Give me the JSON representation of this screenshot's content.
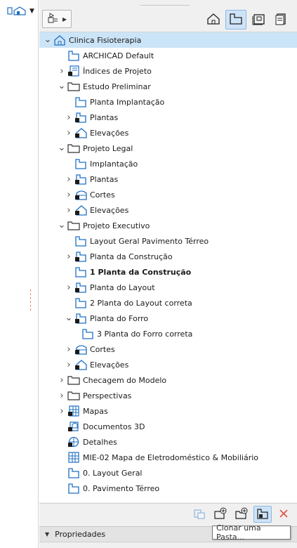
{
  "left_strip": {
    "nav_icon": "house-plan-icon",
    "caret_icon": "caret-down-icon"
  },
  "toolbar": {
    "left_button_icon": "project-map-icon",
    "buttons": [
      {
        "name": "project-map",
        "icon": "house-outline-icon"
      },
      {
        "name": "view-map",
        "icon": "floor-plan-icon",
        "active": true
      },
      {
        "name": "layout-book",
        "icon": "layout-icon"
      },
      {
        "name": "publisher-sets",
        "icon": "publisher-icon"
      }
    ]
  },
  "tree": {
    "rows": [
      {
        "label": "Clinica Fisioterapia",
        "level": 0,
        "toggle": "expanded",
        "icon": "house-icon",
        "selected": true
      },
      {
        "label": "ARCHICAD Default",
        "level": 1,
        "toggle": "none",
        "icon": "plan-view-icon"
      },
      {
        "label": "Índices de Projeto",
        "level": 1,
        "toggle": "collapsed",
        "icon": "index-icon"
      },
      {
        "label": "Estudo Preliminar",
        "level": 1,
        "toggle": "expanded",
        "icon": "folder-icon"
      },
      {
        "label": "Planta Implantação",
        "level": 2,
        "toggle": "none",
        "icon": "plan-view-icon"
      },
      {
        "label": "Plantas",
        "level": 2,
        "toggle": "collapsed",
        "icon": "plan-clone-icon"
      },
      {
        "label": "Elevações",
        "level": 2,
        "toggle": "collapsed",
        "icon": "elevation-clone-icon"
      },
      {
        "label": "Projeto Legal",
        "level": 1,
        "toggle": "expanded",
        "icon": "folder-icon"
      },
      {
        "label": "Implantação",
        "level": 2,
        "toggle": "none",
        "icon": "plan-view-icon"
      },
      {
        "label": "Plantas",
        "level": 2,
        "toggle": "collapsed",
        "icon": "plan-clone-icon"
      },
      {
        "label": "Cortes",
        "level": 2,
        "toggle": "collapsed",
        "icon": "section-clone-icon"
      },
      {
        "label": "Elevações",
        "level": 2,
        "toggle": "collapsed",
        "icon": "elevation-clone-icon"
      },
      {
        "label": "Projeto Executivo",
        "level": 1,
        "toggle": "expanded",
        "icon": "folder-icon"
      },
      {
        "label": "Layout Geral Pavimento Térreo",
        "level": 2,
        "toggle": "none",
        "icon": "plan-view-icon"
      },
      {
        "label": "Planta da Construção",
        "level": 2,
        "toggle": "collapsed",
        "icon": "plan-clone-icon"
      },
      {
        "label": "1 Planta da Construção",
        "level": 2,
        "toggle": "none",
        "icon": "plan-view-icon",
        "bold": true
      },
      {
        "label": "Planta do Layout",
        "level": 2,
        "toggle": "collapsed",
        "icon": "plan-clone-icon"
      },
      {
        "label": "2 Planta do Layout correta",
        "level": 2,
        "toggle": "none",
        "icon": "plan-view-icon"
      },
      {
        "label": "Planta do Forro",
        "level": 2,
        "toggle": "expanded",
        "icon": "plan-clone-icon"
      },
      {
        "label": "3 Planta do Forro correta",
        "level": 3,
        "toggle": "none",
        "icon": "plan-view-icon"
      },
      {
        "label": "Cortes",
        "level": 2,
        "toggle": "collapsed",
        "icon": "section-clone-icon"
      },
      {
        "label": "Elevações",
        "level": 2,
        "toggle": "collapsed",
        "icon": "elevation-clone-icon"
      },
      {
        "label": "Checagem do Modelo",
        "level": 1,
        "toggle": "collapsed",
        "icon": "folder-icon"
      },
      {
        "label": "Perspectivas",
        "level": 1,
        "toggle": "collapsed",
        "icon": "folder-icon"
      },
      {
        "label": "Mapas",
        "level": 1,
        "toggle": "collapsed",
        "icon": "schedule-icon"
      },
      {
        "label": "Documentos 3D",
        "level": 1,
        "toggle": "none",
        "icon": "document-3d-icon"
      },
      {
        "label": "Detalhes",
        "level": 1,
        "toggle": "none",
        "icon": "detail-icon"
      },
      {
        "label": "MIE-02 Mapa de Eletrodoméstico & Mobiliário",
        "level": 1,
        "toggle": "none",
        "icon": "schedule-grid-icon"
      },
      {
        "label": "0. Layout Geral",
        "level": 1,
        "toggle": "none",
        "icon": "plan-view-icon"
      },
      {
        "label": "0. Pavimento Térreo",
        "level": 1,
        "toggle": "none",
        "icon": "plan-view-icon"
      }
    ]
  },
  "bottom_toolbar": {
    "buttons": [
      {
        "name": "clone-folder-disabled",
        "icon": "clone-icon"
      },
      {
        "name": "new-view",
        "icon": "new-view-icon"
      },
      {
        "name": "new-folder",
        "icon": "new-folder-icon"
      },
      {
        "name": "clone-a-folder",
        "icon": "clone-folder-icon",
        "active": true
      },
      {
        "name": "delete",
        "icon": "delete-icon"
      }
    ],
    "tooltip": "Clonar uma Pasta..."
  },
  "properties": {
    "label": "Propriedades"
  },
  "colors": {
    "selection": "#cce4f7",
    "active_button": "#cfe3f7",
    "accent_blue": "#1e6fc2",
    "delete_red": "#e0584f"
  }
}
